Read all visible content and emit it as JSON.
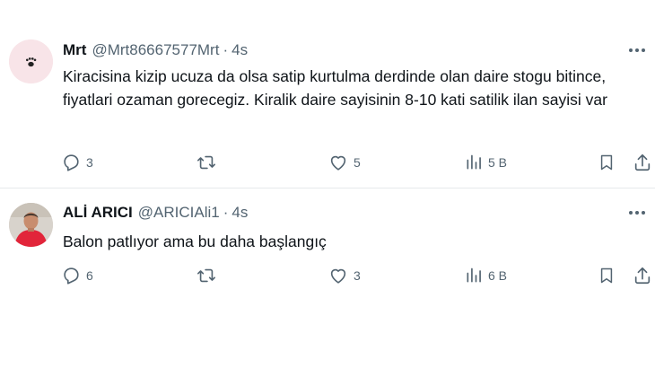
{
  "tweets": [
    {
      "name": "Mrt",
      "handle": "@Mrt86667577Mrt",
      "dot": "·",
      "time": "4s",
      "text": "Kiracisina kizip ucuza da olsa satip kurtulma derdinde olan daire stogu bitince, fiyatlari ozaman gorecegiz. Kiralik daire sayisinin 8-10 kati satilik ilan sayisi var",
      "replies": "3",
      "retweets": "",
      "likes": "5",
      "views": "5 B"
    },
    {
      "name": "ALİ ARICI",
      "handle": "@ARICIAli1",
      "dot": "·",
      "time": "4s",
      "text": "Balon patlıyor ama bu daha başlangıç",
      "replies": "6",
      "retweets": "",
      "likes": "3",
      "views": "6 B"
    }
  ],
  "icons": [
    "reply-icon",
    "retweet-icon",
    "like-icon",
    "views-icon",
    "bookmark-icon",
    "share-icon",
    "more-icon",
    "paw-icon"
  ],
  "colors": {
    "text": "#0f1419",
    "secondary": "#536471",
    "divider": "#e6e9eb"
  }
}
